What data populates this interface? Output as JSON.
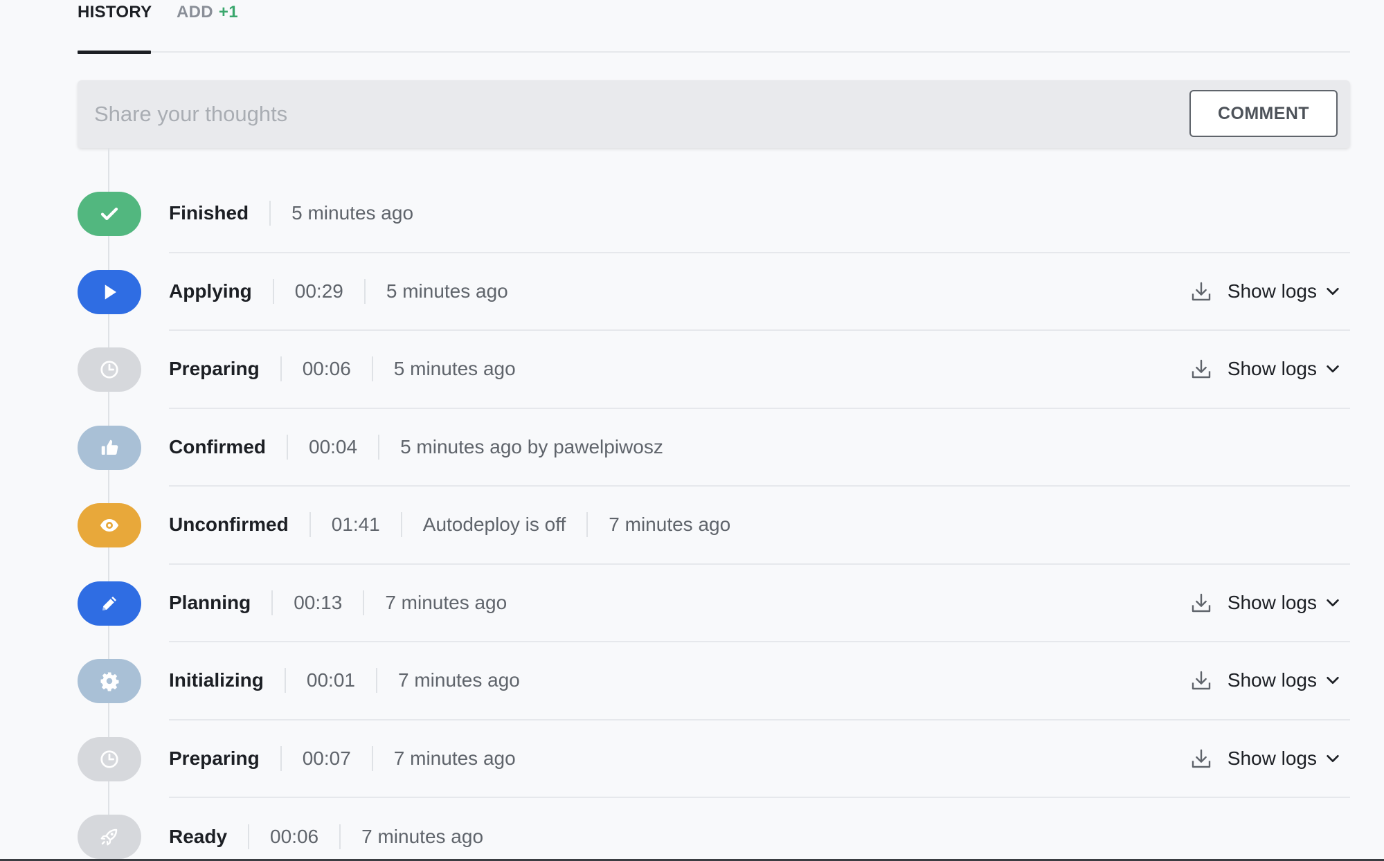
{
  "tabs": {
    "history_label": "HISTORY",
    "add_label": "ADD",
    "add_count": "+1"
  },
  "comment": {
    "placeholder": "Share your thoughts",
    "button_label": "COMMENT"
  },
  "show_logs_label": "Show logs",
  "colors": {
    "green": "#52b77f",
    "blue": "#2f6de3",
    "grey": "#d6d8dc",
    "light_blue": "#a9c0d6",
    "orange": "#e8a83a"
  },
  "timeline": [
    {
      "status": "Finished",
      "icon": "check-icon",
      "color": "green",
      "meta": [
        "5 minutes ago"
      ],
      "logs": false
    },
    {
      "status": "Applying",
      "icon": "play-icon",
      "color": "blue",
      "meta": [
        "00:29",
        "5 minutes ago"
      ],
      "logs": true
    },
    {
      "status": "Preparing",
      "icon": "clock-icon",
      "color": "grey",
      "meta": [
        "00:06",
        "5 minutes ago"
      ],
      "logs": true
    },
    {
      "status": "Confirmed",
      "icon": "thumbs-up-icon",
      "color": "light_blue",
      "meta": [
        "00:04",
        "5 minutes ago by pawelpiwosz"
      ],
      "logs": false
    },
    {
      "status": "Unconfirmed",
      "icon": "eye-icon",
      "color": "orange",
      "meta": [
        "01:41",
        "Autodeploy is off",
        "7 minutes ago"
      ],
      "logs": false
    },
    {
      "status": "Planning",
      "icon": "pencil-icon",
      "color": "blue",
      "meta": [
        "00:13",
        "7 minutes ago"
      ],
      "logs": true
    },
    {
      "status": "Initializing",
      "icon": "gear-icon",
      "color": "light_blue",
      "meta": [
        "00:01",
        "7 minutes ago"
      ],
      "logs": true
    },
    {
      "status": "Preparing",
      "icon": "clock-icon",
      "color": "grey",
      "meta": [
        "00:07",
        "7 minutes ago"
      ],
      "logs": true
    },
    {
      "status": "Ready",
      "icon": "rocket-icon",
      "color": "grey",
      "meta": [
        "00:06",
        "7 minutes ago"
      ],
      "logs": false
    }
  ]
}
